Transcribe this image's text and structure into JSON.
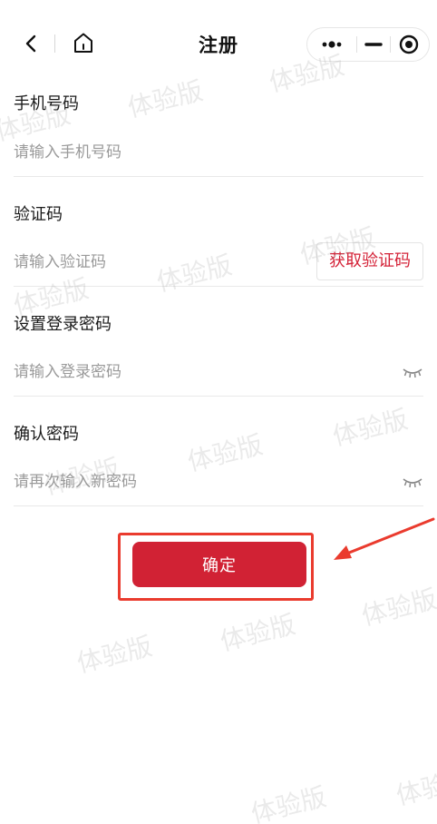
{
  "nav": {
    "title": "注册"
  },
  "form": {
    "phone": {
      "label": "手机号码",
      "placeholder": "请输入手机号码"
    },
    "code": {
      "label": "验证码",
      "placeholder": "请输入验证码",
      "button": "获取验证码"
    },
    "password": {
      "label": "设置登录密码",
      "placeholder": "请输入登录密码"
    },
    "confirm_password": {
      "label": "确认密码",
      "placeholder": "请再次输入新密码"
    }
  },
  "actions": {
    "confirm_label": "确定"
  },
  "watermark": {
    "text": "体验版"
  },
  "colors": {
    "accent": "#d12234",
    "code_button_text": "#d42338",
    "annotation": "#ea3b2e",
    "placeholder": "#9a9a9a"
  },
  "icons": [
    "back-icon",
    "home-icon",
    "more-icon",
    "minimize-icon",
    "close-capsule-icon",
    "eye-closed-icon"
  ]
}
